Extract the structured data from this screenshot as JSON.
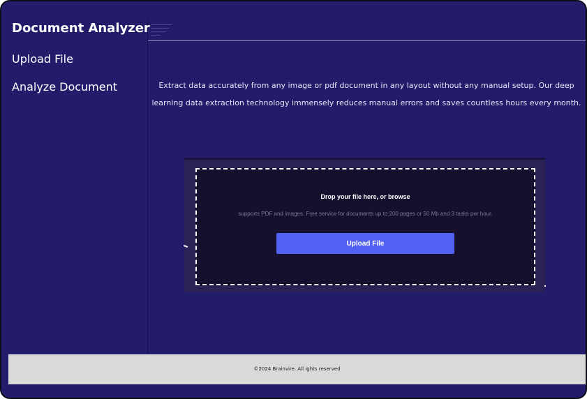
{
  "sidebar": {
    "brand": "Document Analyzer",
    "items": [
      {
        "label": "Upload File"
      },
      {
        "label": "Analyze Document"
      }
    ]
  },
  "main": {
    "description": "Extract data accurately from any image or pdf document in any layout without any manual setup. Our deep learning data extraction technology immensely reduces manual errors and saves countless hours every month.",
    "upload": {
      "title": "Drop your file here, or browse",
      "note": "supports PDF and images. Free service for documents up to 200 pages or 50 Mb and 3 tasks per hour.",
      "button_label": "Upload File"
    }
  },
  "footer": {
    "text": "©2024 Brainvire. All ights reserved"
  },
  "colors": {
    "background": "#221c6b",
    "card": "#2a2155",
    "dropzone": "#170f2e",
    "button": "#5261f2",
    "footer": "#d9d9d9"
  },
  "icons": {
    "menu": "hamburger-icon"
  }
}
